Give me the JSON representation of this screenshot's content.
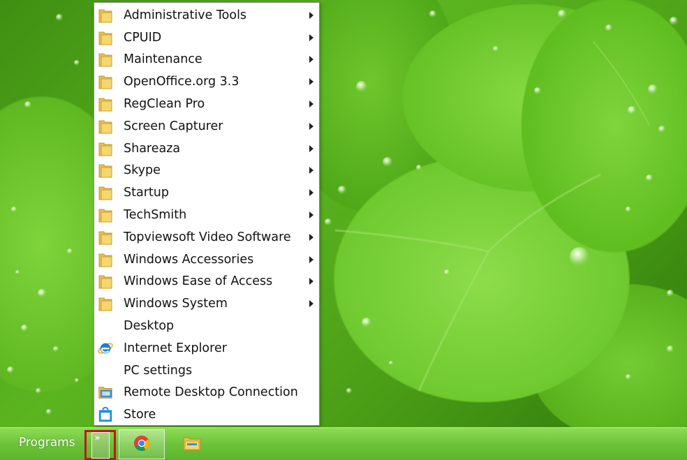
{
  "menu": {
    "items": [
      {
        "label": "Administrative Tools",
        "icon": "folder-icon",
        "submenu": true
      },
      {
        "label": "CPUID",
        "icon": "folder-icon",
        "submenu": true
      },
      {
        "label": "Maintenance",
        "icon": "folder-icon",
        "submenu": true
      },
      {
        "label": "OpenOffice.org 3.3",
        "icon": "folder-icon",
        "submenu": true
      },
      {
        "label": "RegClean Pro",
        "icon": "folder-icon",
        "submenu": true
      },
      {
        "label": "Screen Capturer",
        "icon": "folder-icon",
        "submenu": true
      },
      {
        "label": "Shareaza",
        "icon": "folder-icon",
        "submenu": true
      },
      {
        "label": "Skype",
        "icon": "folder-icon",
        "submenu": true
      },
      {
        "label": "Startup",
        "icon": "folder-icon",
        "submenu": true
      },
      {
        "label": "TechSmith",
        "icon": "folder-icon",
        "submenu": true
      },
      {
        "label": "Topviewsoft Video Software",
        "icon": "folder-icon",
        "submenu": true
      },
      {
        "label": "Windows Accessories",
        "icon": "folder-icon",
        "submenu": true
      },
      {
        "label": "Windows Ease of Access",
        "icon": "folder-icon",
        "submenu": true
      },
      {
        "label": "Windows System",
        "icon": "folder-icon",
        "submenu": true
      },
      {
        "label": "Desktop",
        "icon": "none",
        "submenu": false
      },
      {
        "label": "Internet Explorer",
        "icon": "internet-explorer-icon",
        "submenu": false
      },
      {
        "label": "PC settings",
        "icon": "none",
        "submenu": false
      },
      {
        "label": "Remote Desktop Connection",
        "icon": "remote-desktop-icon",
        "submenu": false
      },
      {
        "label": "Store",
        "icon": "store-icon",
        "submenu": false
      }
    ]
  },
  "taskbar": {
    "programs_label": "Programs",
    "expand_glyph": "»",
    "buttons": [
      {
        "name": "chrome",
        "icon": "chrome-icon",
        "active": true
      },
      {
        "name": "file-explorer",
        "icon": "file-explorer-icon",
        "active": false
      }
    ]
  },
  "colors": {
    "highlight_border": "#c0161d",
    "taskbar": "#6cc33a",
    "menu_background": "#ffffff"
  }
}
